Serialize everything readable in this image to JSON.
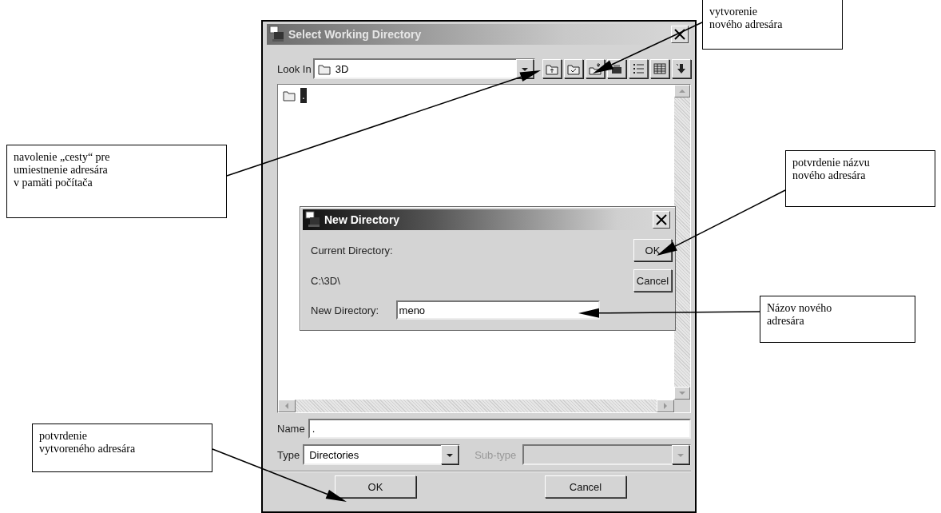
{
  "dialog": {
    "title": "Select Working Directory",
    "look_in": {
      "label": "Look In",
      "value": "3D"
    },
    "files": [
      {
        "name": ".",
        "selected": true
      }
    ],
    "name_field": {
      "label": "Name",
      "value": "."
    },
    "type_field": {
      "label": "Type",
      "value": "Directories"
    },
    "subtype_field": {
      "label": "Sub-type",
      "disabled": true
    },
    "buttons": [
      "OK",
      "Cancel"
    ]
  },
  "new_directory_dialog": {
    "title": "New Directory",
    "current_label": "Current Directory:",
    "current_value": "C:\\3D\\",
    "new_label": "New Directory:",
    "new_value": "meno",
    "buttons": [
      "OK",
      "Cancel"
    ]
  },
  "callouts": [
    {
      "text": "vytvorenie\nnového adresára"
    },
    {
      "text": "navolenie „cesty“ pre\numiestnenie adresára\nv pamäti počítača"
    },
    {
      "text": "potvrdenie názvu\nnového adresára"
    },
    {
      "text": "Názov nového\nadresára"
    },
    {
      "text": "potvrdenie\nvytvoreného adresára"
    }
  ]
}
